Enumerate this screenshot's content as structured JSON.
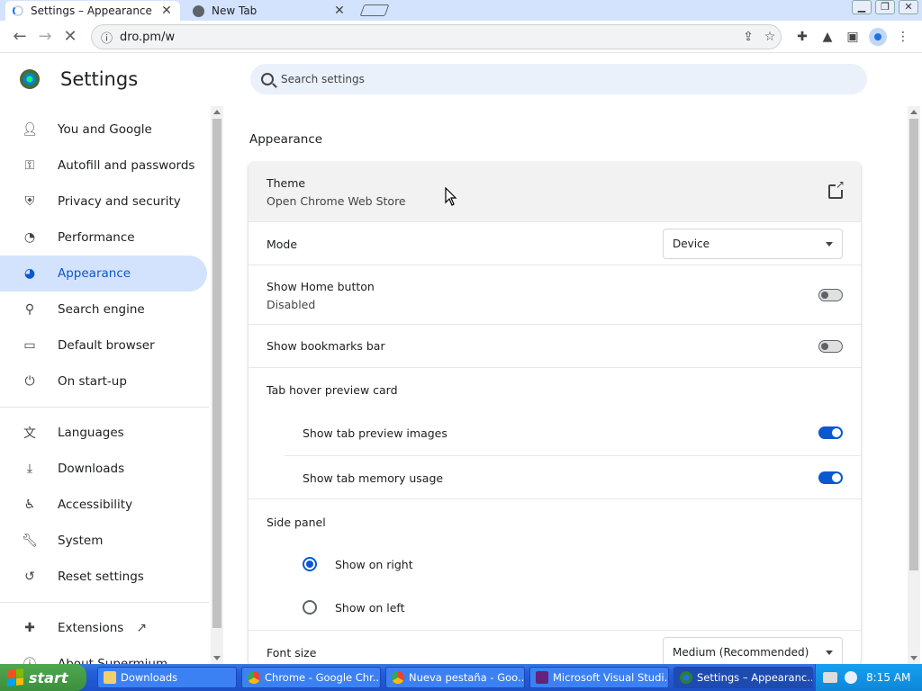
{
  "browser": {
    "tabs": [
      {
        "title": "Settings – Appearance",
        "active": true
      },
      {
        "title": "New Tab",
        "active": false
      }
    ],
    "url": "dro.pm/w"
  },
  "settings": {
    "title": "Settings",
    "search_placeholder": "Search settings",
    "nav": [
      {
        "label": "You and Google",
        "icon": "person-icon"
      },
      {
        "label": "Autofill and passwords",
        "icon": "key-icon"
      },
      {
        "label": "Privacy and security",
        "icon": "shield-icon"
      },
      {
        "label": "Performance",
        "icon": "speedometer-icon"
      },
      {
        "label": "Appearance",
        "icon": "palette-icon",
        "selected": true
      },
      {
        "label": "Search engine",
        "icon": "search-icon"
      },
      {
        "label": "Default browser",
        "icon": "browser-window-icon"
      },
      {
        "label": "On start-up",
        "icon": "power-icon"
      },
      {
        "label": "Languages",
        "icon": "translate-icon"
      },
      {
        "label": "Downloads",
        "icon": "download-icon"
      },
      {
        "label": "Accessibility",
        "icon": "accessibility-icon"
      },
      {
        "label": "System",
        "icon": "wrench-icon"
      },
      {
        "label": "Reset settings",
        "icon": "reset-icon"
      },
      {
        "label": "Extensions",
        "icon": "extension-icon"
      },
      {
        "label": "About Supermium",
        "icon": "info-icon"
      }
    ]
  },
  "appearance": {
    "section_title": "Appearance",
    "theme_label": "Theme",
    "theme_sub": "Open Chrome Web Store",
    "mode_label": "Mode",
    "mode_value": "Device",
    "home_button_label": "Show Home button",
    "home_button_sub": "Disabled",
    "bookmarks_label": "Show bookmarks bar",
    "tab_hover_label": "Tab hover preview card",
    "tab_preview_images_label": "Show tab preview images",
    "tab_memory_label": "Show tab memory usage",
    "side_panel_label": "Side panel",
    "side_right_label": "Show on right",
    "side_left_label": "Show on left",
    "font_size_label": "Font size",
    "font_size_value": "Medium (Recommended)"
  },
  "taskbar": {
    "start_label": "start",
    "items": [
      "Downloads",
      "Chrome - Google Chr...",
      "Nueva pestaña - Goo...",
      "Microsoft Visual Studi...",
      "Settings – Appearanc..."
    ],
    "clock": "8:15 AM"
  },
  "colors": {
    "accent": "#0b57d0",
    "selected_nav_bg": "#d3e3fd",
    "taskbar_blue": "#245edb"
  }
}
